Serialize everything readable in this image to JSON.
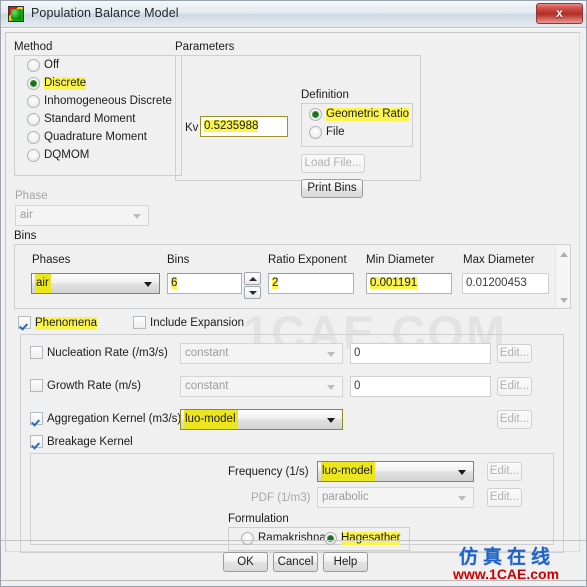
{
  "window": {
    "title": "Population Balance Model",
    "icon": "app-icon",
    "close_label": "x"
  },
  "method": {
    "group_label": "Method",
    "options": [
      {
        "label": "Off",
        "selected": false,
        "highlighted": false
      },
      {
        "label": "Discrete",
        "selected": true,
        "highlighted": true
      },
      {
        "label": "Inhomogeneous Discrete",
        "selected": false,
        "highlighted": false
      },
      {
        "label": "Standard Moment",
        "selected": false,
        "highlighted": false
      },
      {
        "label": "Quadrature Moment",
        "selected": false,
        "highlighted": false
      },
      {
        "label": "DQMOM",
        "selected": false,
        "highlighted": false
      }
    ]
  },
  "phase": {
    "label": "Phase",
    "value": "air",
    "disabled": true
  },
  "parameters": {
    "group_label": "Parameters",
    "kv_label": "Kv",
    "kv_value": "0.5235988",
    "definition": {
      "group_label": "Definition",
      "options": [
        {
          "label": "Geometric Ratio",
          "selected": true,
          "highlighted": true
        },
        {
          "label": "File",
          "selected": false,
          "highlighted": false
        }
      ]
    },
    "load_file_label": "Load File...",
    "load_file_disabled": true,
    "print_bins_label": "Print Bins"
  },
  "bins": {
    "group_label": "Bins",
    "columns": [
      {
        "header": "Phases",
        "type": "combo",
        "value": "air",
        "highlighted": true
      },
      {
        "header": "Bins",
        "type": "text-spinner",
        "value": "6",
        "highlighted": true
      },
      {
        "header": "Ratio Exponent",
        "type": "text",
        "value": "2",
        "highlighted": true
      },
      {
        "header": "Min Diameter",
        "type": "text",
        "value": "0.001191",
        "highlighted": true
      },
      {
        "header": "Max Diameter",
        "type": "text",
        "value": "0.01200453",
        "highlighted": false
      }
    ]
  },
  "phenomena": {
    "label": "Phenomena",
    "checked": true,
    "highlighted": true,
    "include_expansion": {
      "label": "Include Expansion",
      "checked": false
    },
    "rows": [
      {
        "label": "Nucleation Rate (/m3/s)",
        "checked": false,
        "combo_value": "constant",
        "combo_disabled": true,
        "text_value": "0",
        "edit_label": "Edit...",
        "edit_disabled": true
      },
      {
        "label": "Growth Rate (m/s)",
        "checked": false,
        "combo_value": "constant",
        "combo_disabled": true,
        "text_value": "0",
        "edit_label": "Edit...",
        "edit_disabled": true
      },
      {
        "label": "Aggregation Kernel (m3/s)",
        "checked": true,
        "combo_value": "luo-model",
        "combo_disabled": false,
        "combo_highlighted": true,
        "edit_label": "Edit...",
        "edit_disabled": true
      }
    ],
    "breakage": {
      "label": "Breakage Kernel",
      "checked": true,
      "frequency_label": "Frequency (1/s)",
      "frequency_value": "luo-model",
      "frequency_highlighted": true,
      "frequency_edit_label": "Edit...",
      "pdf_label": "PDF (1/m3)",
      "pdf_value": "parabolic",
      "pdf_disabled": true,
      "pdf_edit_label": "Edit...",
      "formulation": {
        "group_label": "Formulation",
        "options": [
          {
            "label": "Ramakrishna",
            "selected": false,
            "highlighted": false
          },
          {
            "label": "Hagesather",
            "selected": true,
            "highlighted": true
          }
        ]
      }
    }
  },
  "footer": {
    "buttons": [
      {
        "label": "OK"
      },
      {
        "label": "Cancel"
      },
      {
        "label": "Help"
      }
    ]
  },
  "watermarks": {
    "faint_text": "1CAE.COM",
    "chinese_text": "仿真在线",
    "url_text": "www.1CAE.com"
  },
  "colors": {
    "highlight_yellow": "#fbf44c",
    "combo_highlight": "#ece61f",
    "title_text": "#22282e",
    "close_red": "#b32d27",
    "watermark_blue": "#1f63c8",
    "watermark_red": "#cc0000"
  }
}
